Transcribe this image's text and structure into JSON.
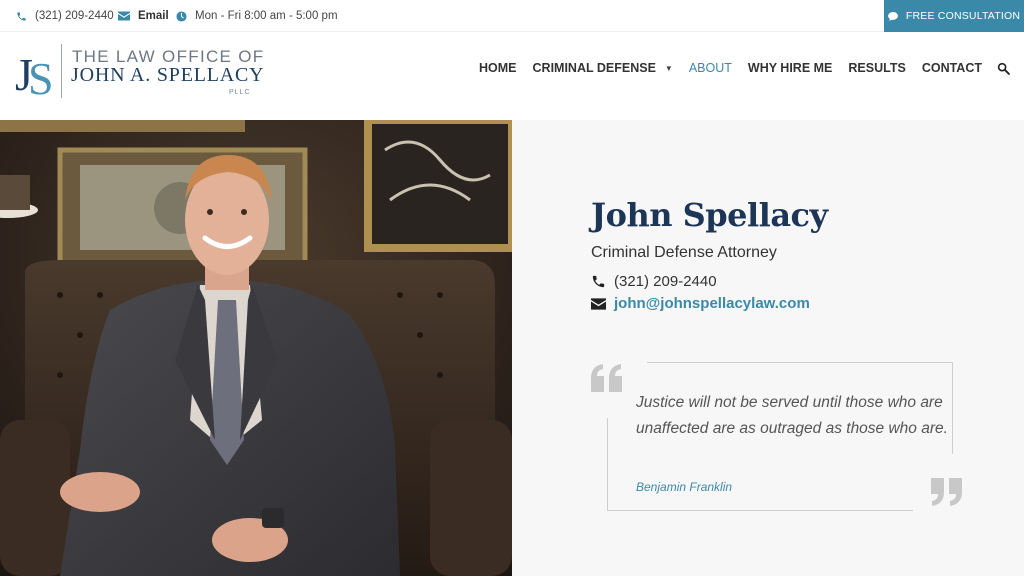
{
  "topbar": {
    "phone": "(321) 209-2440",
    "email_label": "Email",
    "hours": "Mon - Fri 8:00 am - 5:00 pm",
    "cta_label": "FREE CONSULTATION",
    "icons": [
      "phone-icon",
      "envelope-icon",
      "clock-icon",
      "chat-bubble-icon"
    ]
  },
  "logo": {
    "monogram": "JS",
    "line1": "THE LAW OFFICE OF",
    "line2": "JOHN A. SPELLACY",
    "line3": "PLLC"
  },
  "nav": {
    "items": [
      {
        "label": "HOME"
      },
      {
        "label": "CRIMINAL DEFENSE"
      },
      {
        "label": "ABOUT"
      },
      {
        "label": "WHY HIRE ME"
      },
      {
        "label": "RESULTS"
      },
      {
        "label": "CONTACT"
      }
    ],
    "active": "ABOUT",
    "search_icon": "search-icon"
  },
  "profile": {
    "name": "John Spellacy",
    "title": "Criminal Defense Attorney",
    "phone": "(321) 209-2440",
    "email": "john@johnspellacylaw.com"
  },
  "quote": {
    "text": "Justice will not be served until those who are unaffected are as outraged as those who are.",
    "author": "Benjamin Franklin"
  },
  "colors": {
    "accent": "#3b89a8",
    "navy": "#1d3557",
    "panel_bg": "#f7f7f7"
  }
}
